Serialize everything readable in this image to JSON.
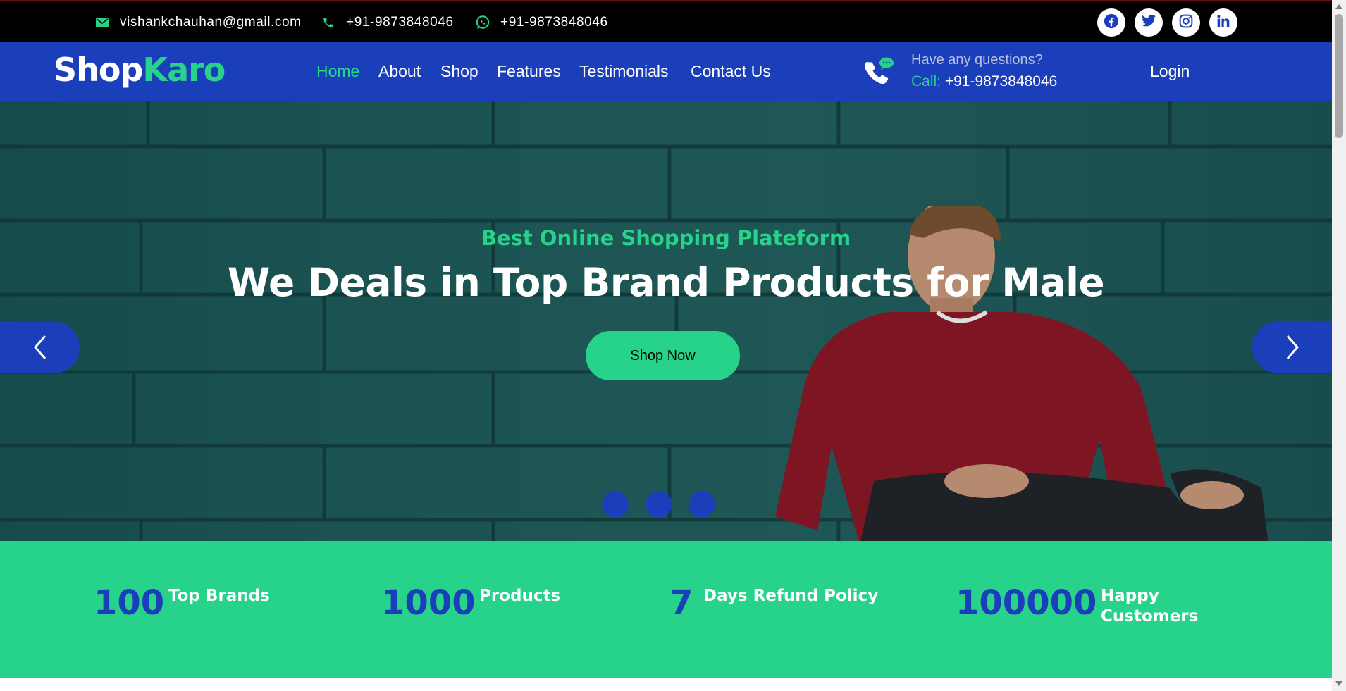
{
  "topbar": {
    "email": "vishankchauhan@gmail.com",
    "phone": "+91-9873848046",
    "whatsapp": "+91-9873848046",
    "social": [
      {
        "icon": "facebook-icon"
      },
      {
        "icon": "twitter-icon"
      },
      {
        "icon": "instagram-icon"
      },
      {
        "icon": "linkedin-icon"
      }
    ]
  },
  "brand": {
    "part1": "Shop",
    "part2": "Karo"
  },
  "nav": {
    "items": [
      {
        "label": "Home",
        "active": true
      },
      {
        "label": "About"
      },
      {
        "label": "Shop"
      },
      {
        "label": "Features"
      },
      {
        "label": "Testimonials"
      },
      {
        "label": "Contact Us"
      }
    ],
    "question": "Have any questions?",
    "call_label": "Call:",
    "call_number": "+91-9873848046",
    "login": "Login"
  },
  "hero": {
    "eyebrow": "Best Online Shopping Plateform",
    "headline": "We Deals in Top Brand Products for Male",
    "button": "Shop Now",
    "slides": 3,
    "active_slide": 1
  },
  "stats": [
    {
      "value": "100",
      "label_line1": "Top Brands",
      "label_line2": ""
    },
    {
      "value": "1000",
      "label_line1": "Products",
      "label_line2": ""
    },
    {
      "value": "7",
      "label_line1": "Days Refund Policy",
      "label_line2": ""
    },
    {
      "value": "100000",
      "label_line1": "Happy",
      "label_line2": "Customers"
    }
  ],
  "colors": {
    "primary": "#1b3fbb",
    "accent": "#27d38a",
    "topbar": "#000000",
    "hero_bg": "#266666"
  }
}
